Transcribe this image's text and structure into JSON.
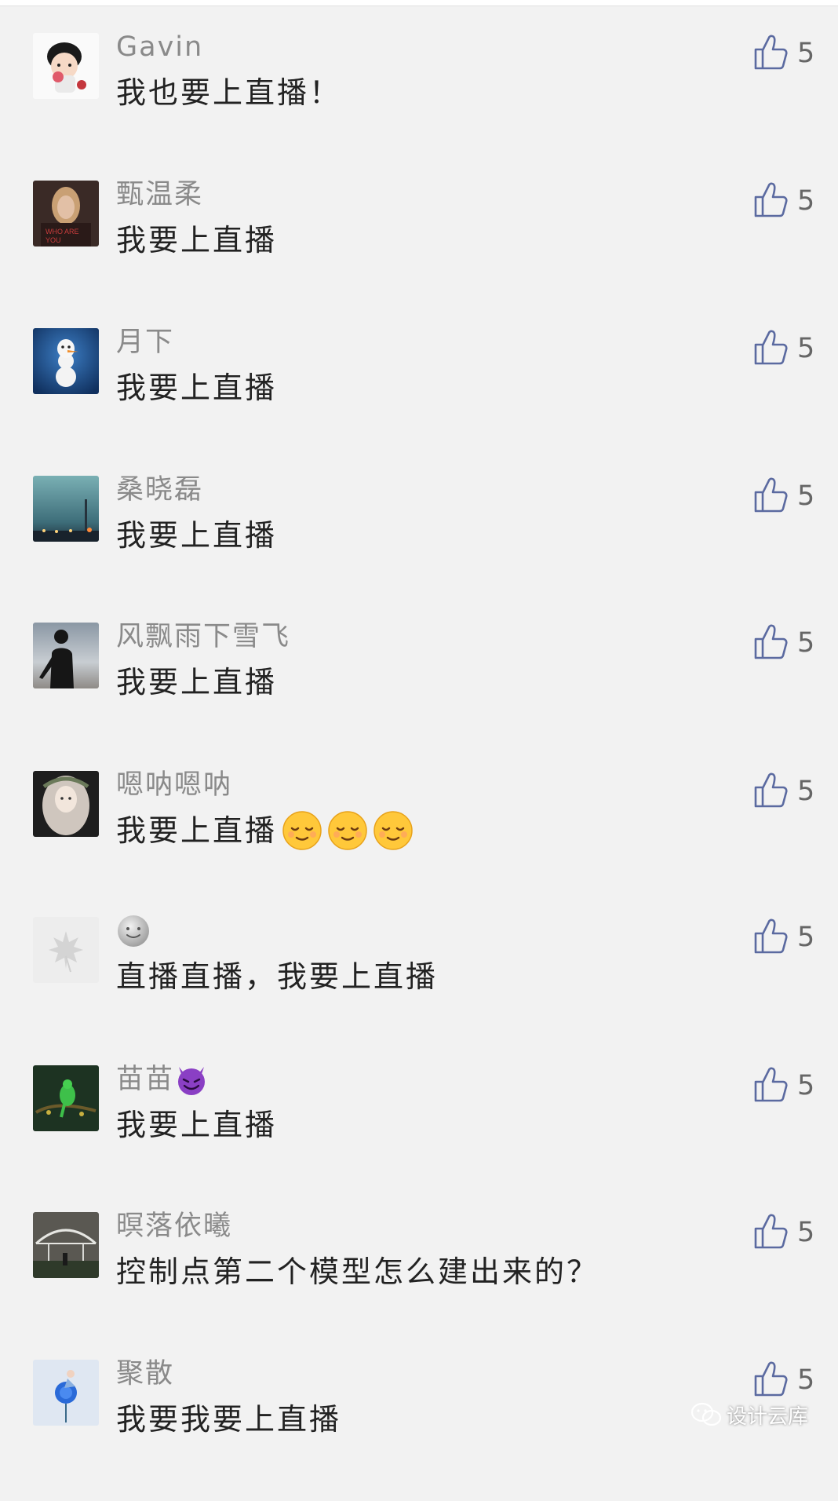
{
  "comments": [
    {
      "nickname": "Gavin",
      "text": "我也要上直播！",
      "likes": "5",
      "avatar": "cartoon-boy-avatar"
    },
    {
      "nickname": "甄温柔",
      "text": "我要上直播",
      "likes": "5",
      "avatar": "girl-photo-avatar"
    },
    {
      "nickname": "月下",
      "text": "我要上直播",
      "likes": "5",
      "avatar": "snowman-avatar"
    },
    {
      "nickname": "桑晓磊",
      "text": "我要上直播",
      "likes": "5",
      "avatar": "city-night-avatar"
    },
    {
      "nickname": "风飘雨下雪飞",
      "text": "我要上直播",
      "likes": "5",
      "avatar": "silhouette-avatar"
    },
    {
      "nickname": "嗯呐嗯呐",
      "text": "我要上直播",
      "likes": "5",
      "avatar": "illustrated-girl-avatar",
      "text_emojis": [
        "relieved-face",
        "relieved-face",
        "relieved-face"
      ]
    },
    {
      "nickname": "",
      "text": "直播直播，我要上直播",
      "likes": "5",
      "avatar": "maple-leaf-avatar",
      "nick_emoji": "moon-face"
    },
    {
      "nickname": "苗苗",
      "text": "我要上直播",
      "likes": "5",
      "avatar": "green-bird-avatar",
      "nick_emoji": "smiling-devil"
    },
    {
      "nickname": "暝落依曦",
      "text": "控制点第二个模型怎么建出来的？",
      "likes": "5",
      "avatar": "greenhouse-avatar"
    },
    {
      "nickname": "聚散",
      "text": "我要我要上直播",
      "likes": "5",
      "avatar": "blue-rose-avatar"
    }
  ],
  "watermark": {
    "text": "设计云库",
    "icon": "wechat-icon"
  },
  "colors": {
    "background": "#f2f2f2",
    "nickname": "#8a8a8a",
    "text": "#222222",
    "like_icon": "#5b6aa0"
  }
}
